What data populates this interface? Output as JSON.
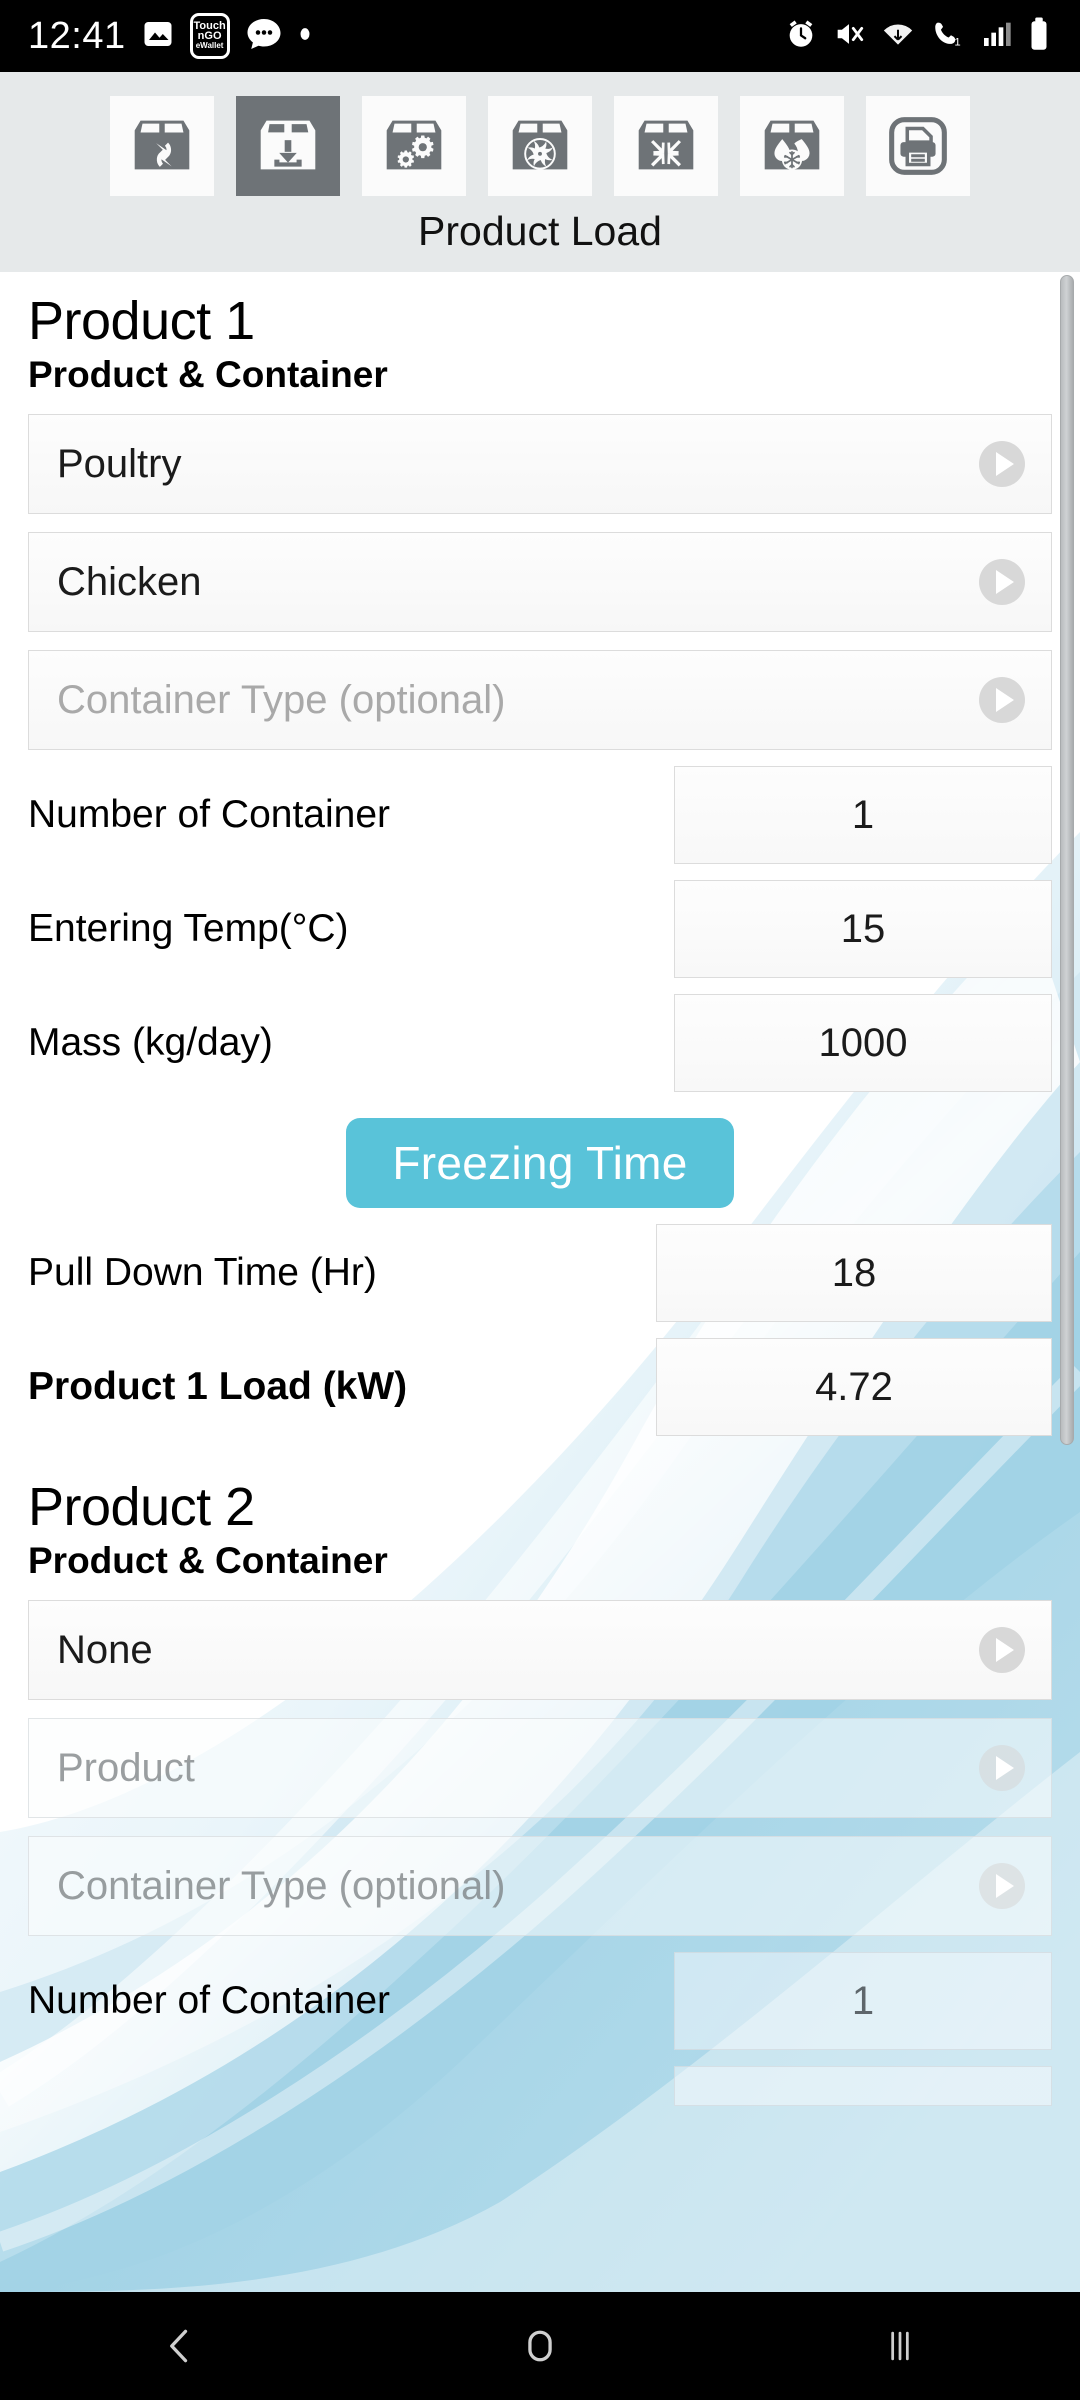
{
  "status_bar": {
    "time": "12:41",
    "left_icons": [
      "photos-icon",
      "touch-n-go-wallet-icon",
      "message-icon",
      "dot-icon"
    ],
    "wallet_line1": "Touch",
    "wallet_line2": "nGO",
    "wallet_line3": "eWallet",
    "right_icons": [
      "alarm-icon",
      "mute-icon",
      "wifi-icon",
      "call-wifi-icon",
      "signal-icon",
      "battery-icon"
    ]
  },
  "toolbar": {
    "title": "Product Load",
    "buttons": [
      {
        "name": "transmission-load-icon",
        "label": "Transmission Load",
        "selected": false
      },
      {
        "name": "product-load-icon",
        "label": "Product Load",
        "selected": true
      },
      {
        "name": "equipment-load-icon",
        "label": "Equipment Load",
        "selected": false
      },
      {
        "name": "ventilation-load-icon",
        "label": "Ventilation Load",
        "selected": false
      },
      {
        "name": "infiltration-load-icon",
        "label": "Infiltration Load",
        "selected": false
      },
      {
        "name": "defrost-load-icon",
        "label": "Defrost Load",
        "selected": false
      },
      {
        "name": "print-icon",
        "label": "Print",
        "selected": false
      }
    ]
  },
  "products": [
    {
      "heading": "Product 1",
      "sub_heading": "Product & Container",
      "category_value": "Poultry",
      "product_value": "Chicken",
      "container_placeholder": "Container Type (optional)",
      "container_value": "",
      "rows": [
        {
          "label": "Number of Container",
          "value": "1",
          "bold": false
        },
        {
          "label": "Entering Temp(°C)",
          "value": "15",
          "bold": false
        },
        {
          "label": "Mass (kg/day)",
          "value": "1000",
          "bold": false
        }
      ],
      "freezing_button": "Freezing Time",
      "rows2": [
        {
          "label": "Pull Down Time (Hr)",
          "value": "18",
          "bold": false
        },
        {
          "label": "Product 1 Load (kW)",
          "value": "4.72",
          "bold": true
        }
      ]
    },
    {
      "heading": "Product 2",
      "sub_heading": "Product & Container",
      "category_value": "None",
      "product_placeholder": "Product",
      "container_placeholder": "Container Type (optional)",
      "rows": [
        {
          "label": "Number of Container",
          "value": "1",
          "bold": false
        }
      ]
    }
  ],
  "scrollbar": {
    "name": "vertical-scrollbar"
  },
  "nav_bar": {
    "back": "back-icon",
    "home": "home-icon",
    "recents": "recents-icon"
  },
  "colors": {
    "accent": "#59c3d9",
    "toolbar_bg": "#e6e9ea",
    "icon_gray": "#6e7377"
  }
}
